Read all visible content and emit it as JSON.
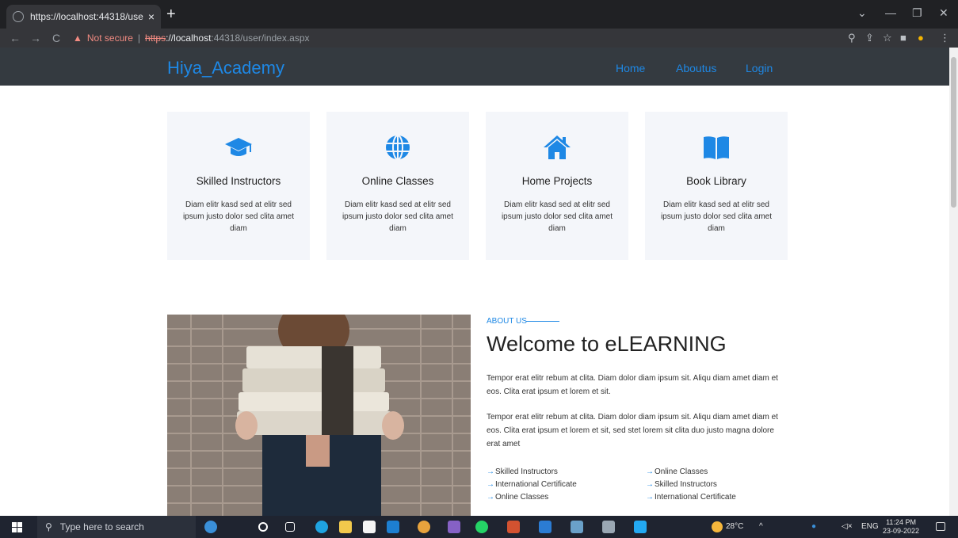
{
  "browser": {
    "tab_title": "https://localhost:44318/user/ind",
    "tab_close": "×",
    "new_tab": "+",
    "not_secure": "Not secure",
    "url_scheme": "https",
    "url_host": "://localhost",
    "url_port_path": ":44318/user/index.aspx"
  },
  "site": {
    "brand": "Hiya_Academy",
    "nav": [
      "Home",
      "Aboutus",
      "Login"
    ]
  },
  "cards": [
    {
      "title": "Skilled Instructors",
      "desc": "Diam elitr kasd sed at elitr sed ipsum justo dolor sed clita amet diam",
      "icon": "graduation-cap-icon"
    },
    {
      "title": "Online Classes",
      "desc": "Diam elitr kasd sed at elitr sed ipsum justo dolor sed clita amet diam",
      "icon": "globe-icon"
    },
    {
      "title": "Home Projects",
      "desc": "Diam elitr kasd sed at elitr sed ipsum justo dolor sed clita amet diam",
      "icon": "home-icon"
    },
    {
      "title": "Book Library",
      "desc": "Diam elitr kasd sed at elitr sed ipsum justo dolor sed clita amet diam",
      "icon": "book-icon"
    }
  ],
  "about": {
    "label": "ABOUT US",
    "heading": "Welcome to eLEARNING",
    "para1": "Tempor erat elitr rebum at clita. Diam dolor diam ipsum sit. Aliqu diam amet diam et eos. Clita erat ipsum et lorem et sit.",
    "para2": "Tempor erat elitr rebum at clita. Diam dolor diam ipsum sit. Aliqu diam amet diam et eos. Clita erat ipsum et lorem et sit, sed stet lorem sit clita duo justo magna dolore erat amet",
    "features_left": [
      "Skilled Instructors",
      "International Certificate",
      "Online Classes"
    ],
    "features_right": [
      "Online Classes",
      "Skilled Instructors",
      "International Certificate"
    ]
  },
  "taskbar": {
    "search_placeholder": "Type here to search",
    "weather": "28°C",
    "lang": "ENG",
    "time": "11:24 PM",
    "date": "23-09-2022"
  },
  "colors": {
    "accent": "#1e88e5",
    "header_bg": "#343a40",
    "card_bg": "#f4f6fa"
  }
}
